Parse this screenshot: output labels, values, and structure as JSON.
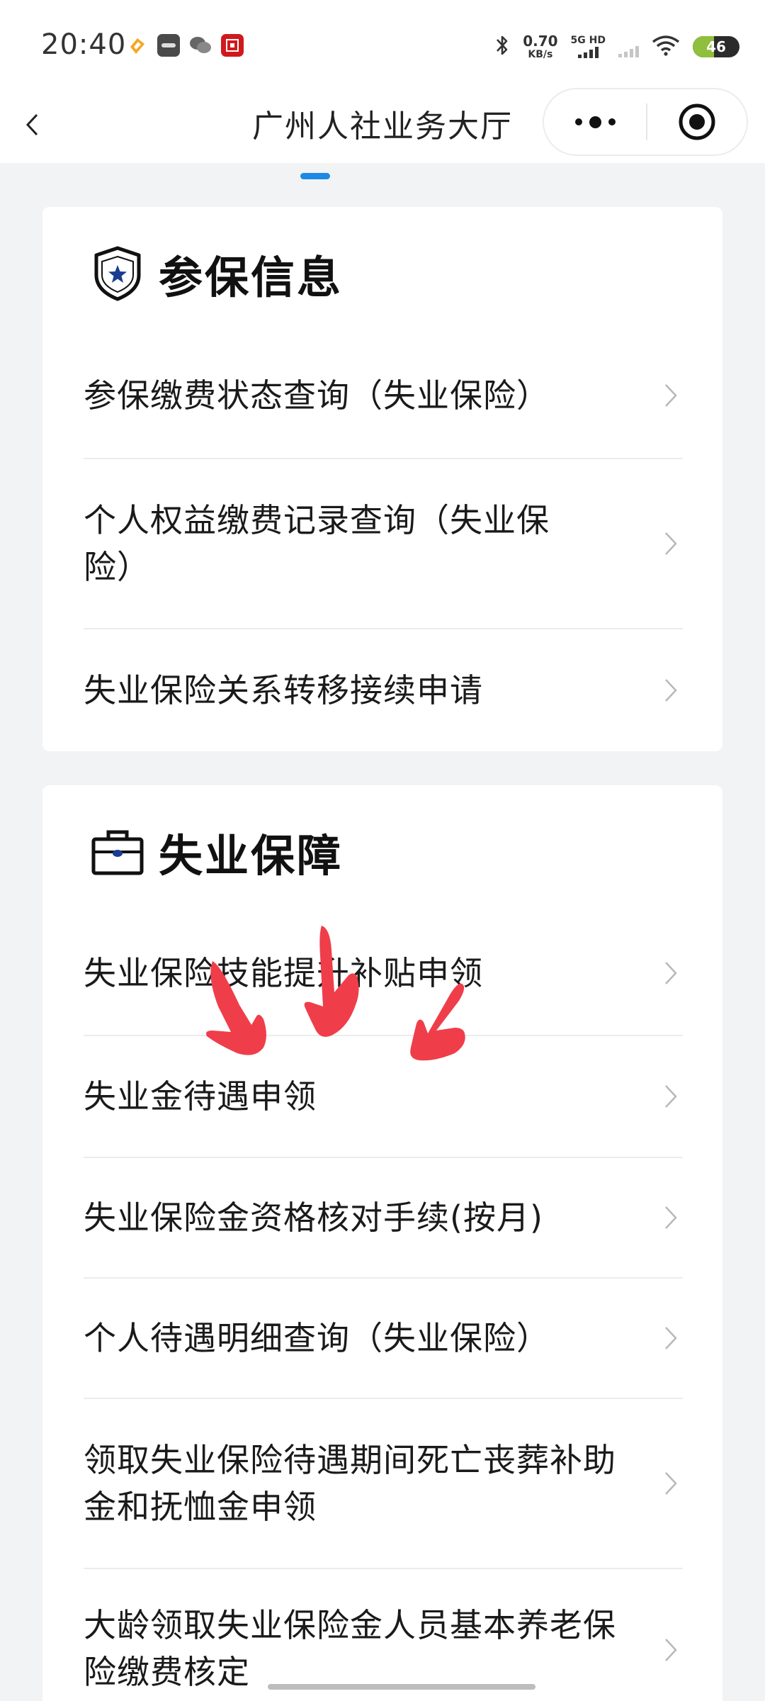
{
  "status_bar": {
    "time": "20:40",
    "net_speed_value": "0.70",
    "net_speed_unit": "KB/s",
    "network_label": "5G HD",
    "battery_level": "46",
    "icons": [
      "fire-app-icon",
      "vivo-app-icon",
      "wechat-icon",
      "bank-app-icon",
      "bluetooth-icon",
      "wifi-icon"
    ]
  },
  "nav": {
    "title": "广州人社业务大厅",
    "back_icon": "chevron-left-icon",
    "more_icon": "more-dots-icon",
    "close_icon": "target-close-icon"
  },
  "sections": [
    {
      "title": "参保信息",
      "icon": "shield-star-icon",
      "items": [
        {
          "label": "参保缴费状态查询（失业保险）"
        },
        {
          "label": "个人权益缴费记录查询（失业保险）"
        },
        {
          "label": "失业保险关系转移接续申请"
        }
      ]
    },
    {
      "title": "失业保障",
      "icon": "briefcase-icon",
      "items": [
        {
          "label": "失业保险技能提升补贴申领"
        },
        {
          "label": "失业金待遇申领"
        },
        {
          "label": "失业保险金资格核对手续(按月)"
        },
        {
          "label": "个人待遇明细查询（失业保险）"
        },
        {
          "label": "领取失业保险待遇期间死亡丧葬补助金和抚恤金申领"
        },
        {
          "label": "大龄领取失业保险金人员基本养老保险缴费核定"
        }
      ]
    }
  ],
  "colors": {
    "accent": "#1e88e5",
    "annotation_arrow": "#ef3e4a",
    "page_background": "#f2f3f5"
  }
}
